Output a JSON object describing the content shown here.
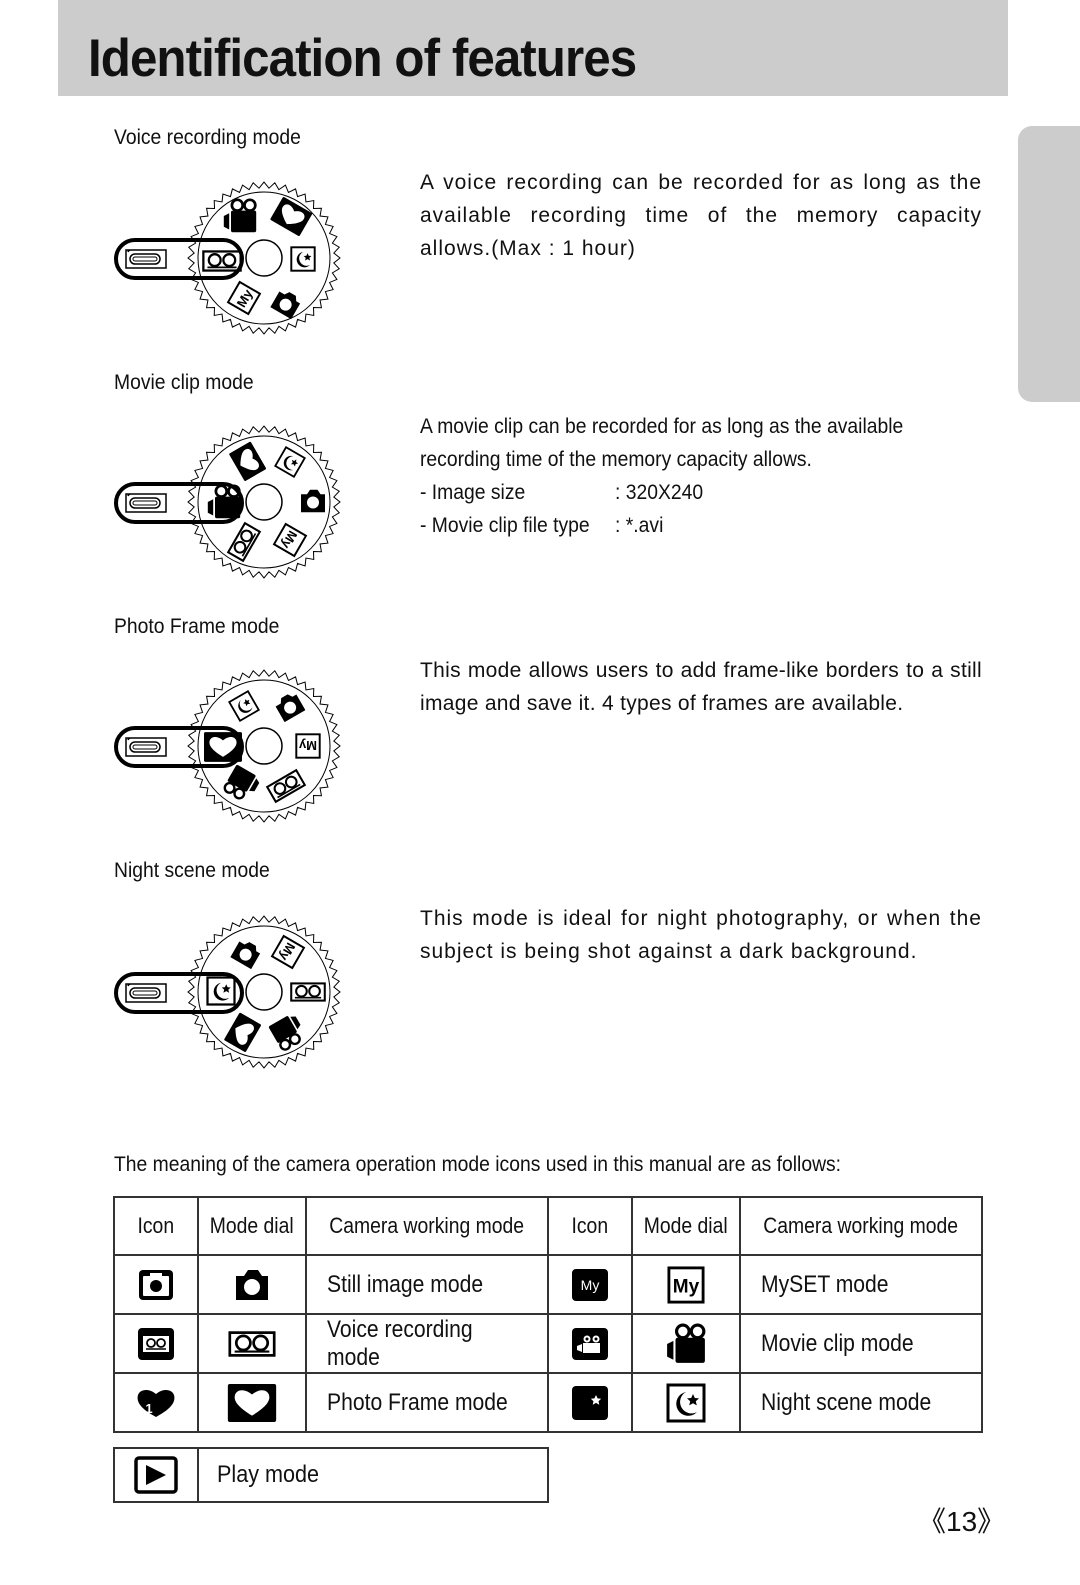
{
  "header": {
    "title": "Identification of features"
  },
  "sections": [
    {
      "label": "Voice recording mode",
      "description": "A voice recording can be recorded for as long as the available recording time of the memory capacity allows.(Max : 1 hour)",
      "dial_selected": "voice-recording-icon"
    },
    {
      "label": "Movie clip mode",
      "description": "A movie clip can be recorded for as long as the available recording time of the memory capacity allows.",
      "specs": [
        {
          "key": "- Image size",
          "value": ": 320X240"
        },
        {
          "key": "- Movie clip file type",
          "value": ": *.avi"
        }
      ],
      "dial_selected": "movie-clip-icon"
    },
    {
      "label": "Photo Frame mode",
      "description": "This mode allows users to add frame-like borders to a still image and save it. 4 types of frames are available.",
      "dial_selected": "photo-frame-icon"
    },
    {
      "label": "Night scene mode",
      "description": "This mode is ideal for night photography, or when the subject is being shot against a dark background.",
      "dial_selected": "night-scene-icon"
    }
  ],
  "icon_table": {
    "intro": "The meaning of the camera operation mode icons used in this manual are as follows:",
    "headers": [
      "Icon",
      "Mode dial",
      "Camera working mode",
      "Icon",
      "Mode dial",
      "Camera working mode"
    ],
    "rows": [
      {
        "left": {
          "icon": "still-image-icon",
          "mode": "Still image mode"
        },
        "right": {
          "icon": "myset-icon",
          "icon_text": "My",
          "mode": "MySET mode"
        }
      },
      {
        "left": {
          "icon": "voice-recording-icon",
          "mode": "Voice recording mode"
        },
        "right": {
          "icon": "movie-clip-icon",
          "mode": "Movie clip mode"
        }
      },
      {
        "left": {
          "icon": "photo-frame-icon",
          "icon_text": "1",
          "mode": "Photo Frame mode"
        },
        "right": {
          "icon": "night-scene-icon",
          "mode": "Night scene mode"
        }
      }
    ],
    "play": {
      "icon": "play-icon",
      "mode": "Play mode"
    }
  },
  "footer": {
    "page_number": "《13》"
  },
  "colors": {
    "band_gray": "#cccccc",
    "ink": "#111111"
  }
}
